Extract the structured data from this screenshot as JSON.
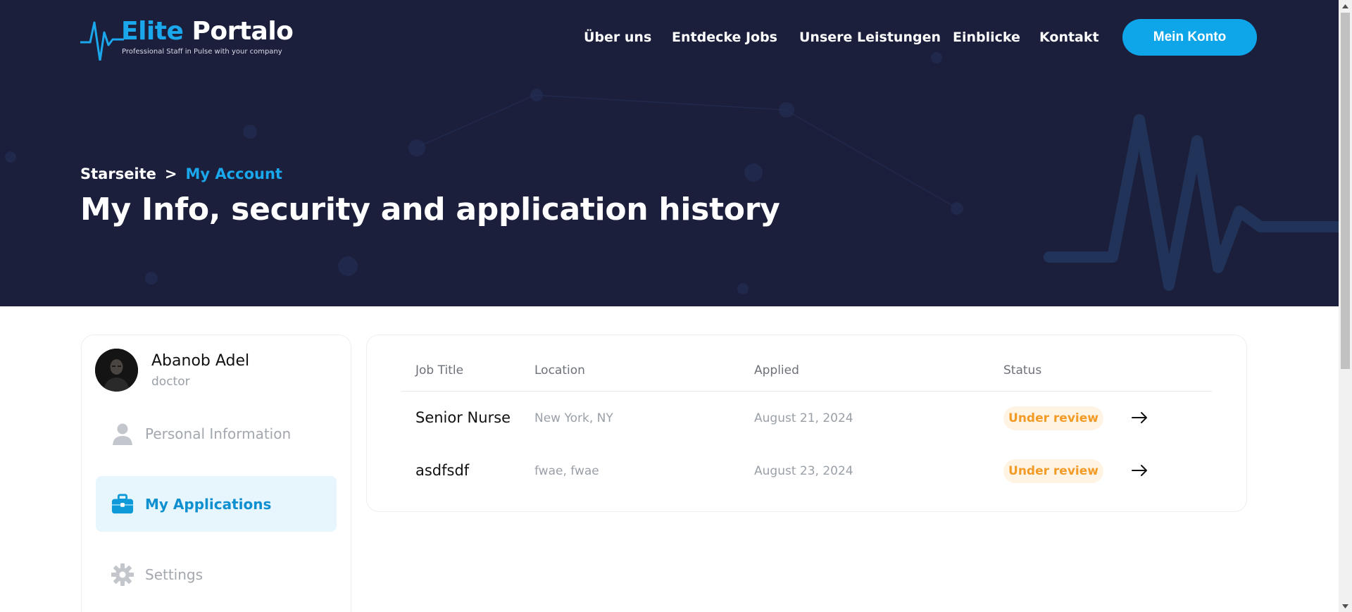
{
  "brand": {
    "name_part1": "Elite",
    "name_part2": "Portalo",
    "tagline": "Professional Staff in Pulse with your company"
  },
  "nav": {
    "items": [
      "Über uns",
      "Entdecke Jobs",
      "Unsere Leistungen",
      "Einblicke",
      "Kontakt"
    ],
    "account_button": "Mein Konto"
  },
  "hero": {
    "breadcrumb_home": "Starseite",
    "breadcrumb_separator": ">",
    "breadcrumb_current": "My Account",
    "title": "My Info, security and application history"
  },
  "profile": {
    "name": "Abanob Adel",
    "role": "doctor"
  },
  "sidebar": {
    "items": [
      {
        "label": "Personal Information",
        "icon": "user-icon",
        "active": false
      },
      {
        "label": "My Applications",
        "icon": "briefcase-icon",
        "active": true
      },
      {
        "label": "Settings",
        "icon": "gear-icon",
        "active": false
      }
    ]
  },
  "applications": {
    "columns": [
      "Job Title",
      "Location",
      "Applied",
      "Status"
    ],
    "rows": [
      {
        "title": "Senior Nurse",
        "location": "New York, NY",
        "applied": "August 21, 2024",
        "status": "Under review"
      },
      {
        "title": "asdfsdf",
        "location": "fwae, fwae",
        "applied": "August 23, 2024",
        "status": "Under review"
      }
    ]
  },
  "colors": {
    "hero_bg": "#1b1f3b",
    "accent": "#0ea5e9",
    "status_bg": "#fff4e3",
    "status_text": "#f29b26"
  }
}
